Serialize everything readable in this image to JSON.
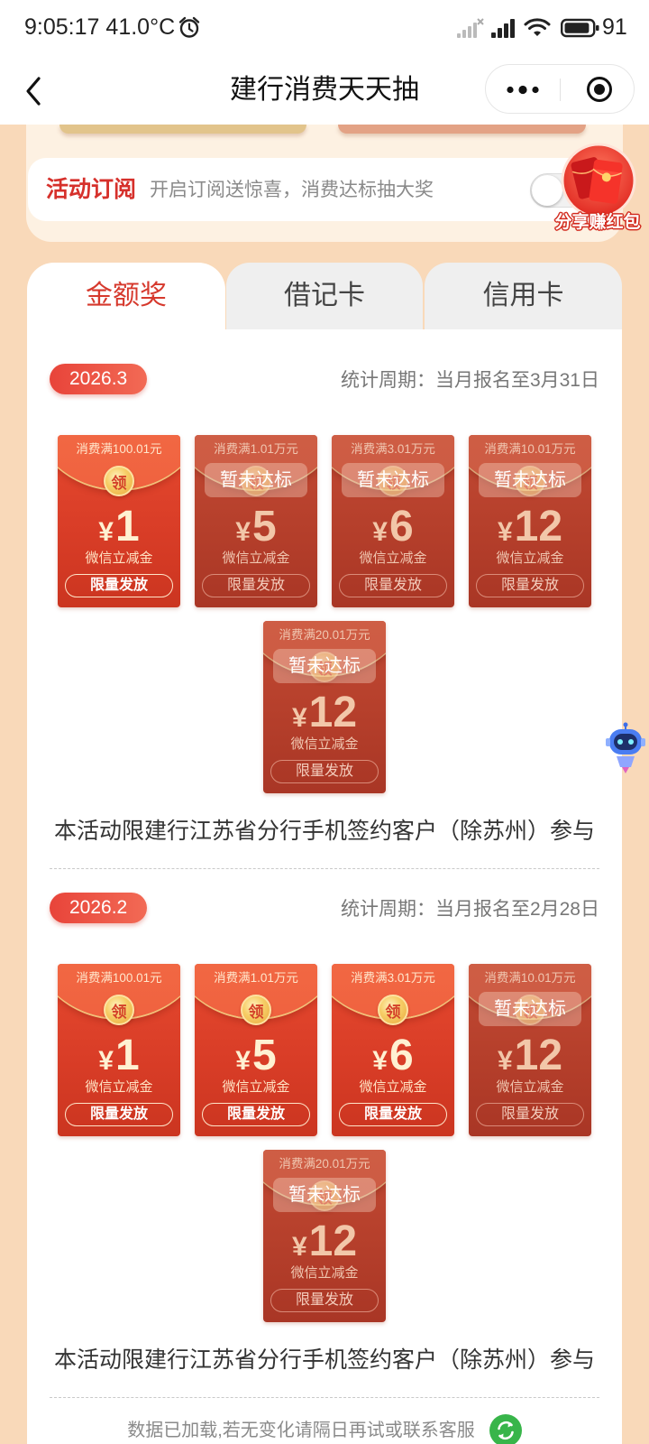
{
  "status_bar": {
    "time": "9:05:17",
    "temperature": "41.0°C",
    "battery": "91",
    "icons": [
      "alarm-clock-icon",
      "no-signal-icon",
      "signal-icon",
      "wifi-icon",
      "battery-icon"
    ]
  },
  "nav": {
    "title": "建行消费天天抽",
    "back_icon": "chevron-left-icon",
    "menu_icon": "more-dots-icon",
    "close_icon": "target-icon"
  },
  "subscribe": {
    "label": "活动订阅",
    "description": "开启订阅送惊喜，消费达标抽大奖",
    "enabled": false
  },
  "share": {
    "label": "分享赚红包",
    "icon": "red-packet-icon"
  },
  "tabs": [
    {
      "label": "金额奖",
      "active": true
    },
    {
      "label": "借记卡",
      "active": false
    },
    {
      "label": "信用卡",
      "active": false
    }
  ],
  "sections": [
    {
      "period": "2026.3",
      "stat": "统计周期：当月报名至3月31日",
      "note": "本活动限建行江苏省分行手机签约客户（除苏州）参与",
      "rewards": [
        {
          "threshold": "消费满100.01元",
          "coin": "领",
          "currency": "¥",
          "amount": "1",
          "type": "微信立减金",
          "button": "限量发放",
          "locked": false
        },
        {
          "threshold": "消费满1.01万元",
          "coin": "领",
          "currency": "¥",
          "amount": "5",
          "type": "微信立减金",
          "button": "限量发放",
          "locked": true,
          "locked_label": "暂未达标"
        },
        {
          "threshold": "消费满3.01万元",
          "coin": "领",
          "currency": "¥",
          "amount": "6",
          "type": "微信立减金",
          "button": "限量发放",
          "locked": true,
          "locked_label": "暂未达标"
        },
        {
          "threshold": "消费满10.01万元",
          "coin": "领",
          "currency": "¥",
          "amount": "12",
          "type": "微信立减金",
          "button": "限量发放",
          "locked": true,
          "locked_label": "暂未达标"
        },
        {
          "threshold": "消费满20.01万元",
          "coin": "领",
          "currency": "¥",
          "amount": "12",
          "type": "微信立减金",
          "button": "限量发放",
          "locked": true,
          "locked_label": "暂未达标"
        }
      ]
    },
    {
      "period": "2026.2",
      "stat": "统计周期：当月报名至2月28日",
      "note": "本活动限建行江苏省分行手机签约客户（除苏州）参与",
      "rewards": [
        {
          "threshold": "消费满100.01元",
          "coin": "领",
          "currency": "¥",
          "amount": "1",
          "type": "微信立减金",
          "button": "限量发放",
          "locked": false
        },
        {
          "threshold": "消费满1.01万元",
          "coin": "领",
          "currency": "¥",
          "amount": "5",
          "type": "微信立减金",
          "button": "限量发放",
          "locked": false
        },
        {
          "threshold": "消费满3.01万元",
          "coin": "领",
          "currency": "¥",
          "amount": "6",
          "type": "微信立减金",
          "button": "限量发放",
          "locked": false
        },
        {
          "threshold": "消费满10.01万元",
          "coin": "领",
          "currency": "¥",
          "amount": "12",
          "type": "微信立减金",
          "button": "限量发放",
          "locked": true,
          "locked_label": "暂未达标"
        },
        {
          "threshold": "消费满20.01万元",
          "coin": "领",
          "currency": "¥",
          "amount": "12",
          "type": "微信立减金",
          "button": "限量发放",
          "locked": true,
          "locked_label": "暂未达标"
        }
      ]
    }
  ],
  "footer": {
    "text": "数据已加载,若无变化请隔日再试或联系客服",
    "icon": "refresh-icon"
  },
  "assistant": {
    "icon": "robot-icon"
  },
  "colors": {
    "accent": "#d6392d",
    "packet_red": "#e2472f",
    "page_background": "#f9d9b9",
    "refresh_green": "#38b54a"
  }
}
